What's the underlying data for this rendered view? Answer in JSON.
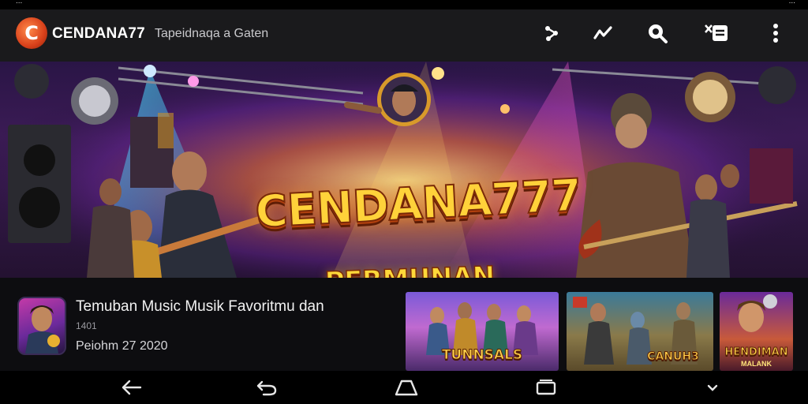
{
  "status_bar": {
    "left_text": "...",
    "right_text": "..."
  },
  "app_bar": {
    "title": "CENDANA77",
    "subtitle": "Tapeidnaqa a Gaten",
    "logo_letter": "C",
    "actions": [
      "share-icon",
      "trend-icon",
      "search-icon",
      "cast-icon",
      "more-vert-icon"
    ]
  },
  "hero": {
    "title": "CENDANA777",
    "tagline": "PERMUNAN FANTASTIS"
  },
  "featured": {
    "title": "Temuban Music Musik Favoritmu dan",
    "meta": "1401",
    "date": "Peiohm 27 2020"
  },
  "thumbnails": [
    {
      "label": "TUNNSALS",
      "sub": ""
    },
    {
      "label": "CANUH3",
      "sub": ""
    },
    {
      "label": "HENDIMAN",
      "sub": "MALANK"
    }
  ],
  "nav": [
    "back-icon",
    "undo-icon",
    "home-icon",
    "recents-icon",
    "chevron-down-icon"
  ],
  "colors": {
    "app_bar_bg": "#1a1a1c",
    "accent_gold": "#ffd23a",
    "logo_orange": "#e0521e"
  }
}
